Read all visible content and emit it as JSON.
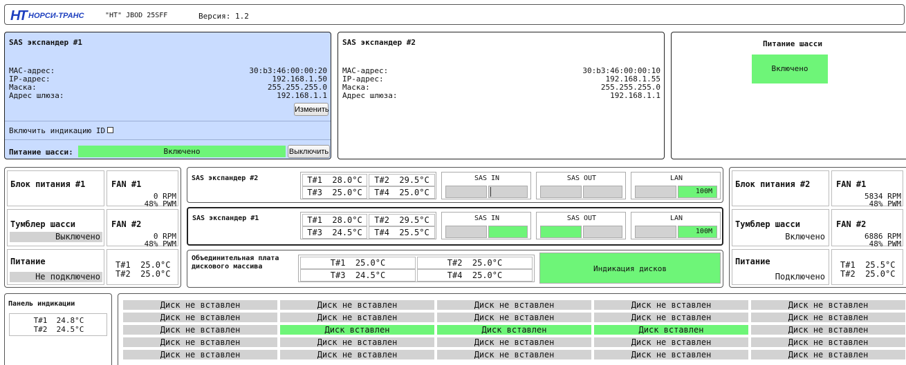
{
  "header": {
    "logo_text": "НОРСИ-ТРАНС",
    "device": "\"НТ\" JBOD 25SFF",
    "version": "Версия: 1.2"
  },
  "exp1_panel": {
    "title": "SAS экспандер #1",
    "mac_label": "MAC-адрес:",
    "mac": "30:b3:46:00:00:20",
    "ip_label": "IP-адрес:",
    "ip": "192.168.1.50",
    "mask_label": "Маска:",
    "mask": "255.255.255.0",
    "gw_label": "Адрес шлюза:",
    "gw": "192.168.1.1",
    "edit_button": "Изменить",
    "id_label": "Включить индикацию ID",
    "power_label": "Питание шасси:",
    "power_value": "Включено",
    "power_button": "Выключить"
  },
  "exp2_panel": {
    "title": "SAS экспандер #2",
    "mac_label": "MAC-адрес:",
    "mac": "30:b3:46:00:00:10",
    "ip_label": "IP-адрес:",
    "ip": "192.168.1.55",
    "mask_label": "Маска:",
    "mask": "255.255.255.0",
    "gw_label": "Адрес шлюза:",
    "gw": "192.168.1.1"
  },
  "chassis_power": {
    "title": "Питание шасси",
    "value": "Включено"
  },
  "psu1": {
    "title": "Блок питания #1",
    "fan1_title": "FAN #1",
    "fan1_rpm": "0 RPM",
    "fan1_pwm": "48% PWM",
    "switch_title": "Тумблер шасси",
    "switch_value": "Выключено",
    "fan2_title": "FAN #2",
    "fan2_rpm": "0 RPM",
    "fan2_pwm": "48% PWM",
    "power_title": "Питание",
    "power_value": "Не подключено",
    "t1": "T#1  25.0°C",
    "t2": "T#2  25.0°C"
  },
  "psu2": {
    "title": "Блок питания #2",
    "fan1_title": "FAN #1",
    "fan1_rpm": "5834 RPM",
    "fan1_pwm": "48% PWM",
    "switch_title": "Тумблер шасси",
    "switch_value": "Включено",
    "fan2_title": "FAN #2",
    "fan2_rpm": "6886 RPM",
    "fan2_pwm": "48% PWM",
    "power_title": "Питание",
    "power_value": "Подключено",
    "t1": "T#1  25.5°C",
    "t2": "T#2  25.0°C"
  },
  "exp2_status": {
    "title": "SAS экспандер #2",
    "t1": "T#1  28.0°C",
    "t2": "T#2  29.5°C",
    "t3": "T#3  25.0°C",
    "t4": "T#4  25.0°C",
    "sas_in": "SAS IN",
    "sas_out": "SAS OUT",
    "lan": "LAN",
    "lan_speed": "100M"
  },
  "exp1_status": {
    "title": "SAS экспандер #1",
    "t1": "T#1  28.0°C",
    "t2": "T#2  29.5°C",
    "t3": "T#3  24.5°C",
    "t4": "T#4  25.5°C",
    "sas_in": "SAS IN",
    "sas_out": "SAS OUT",
    "lan": "LAN",
    "lan_speed": "100M"
  },
  "backplane": {
    "title_line1": "Объединительная плата",
    "title_line2": "дискового массива",
    "t1": "T#1  25.0°C",
    "t2": "T#2  25.0°C",
    "t3": "T#3  24.5°C",
    "t4": "T#4  25.0°C",
    "indication_button": "Индикация дисков"
  },
  "indicator_panel": {
    "title": "Панель индикации",
    "t1": "T#1  24.8°C",
    "t2": "T#2  24.5°C"
  },
  "disks": {
    "absent": "Диск не вставлен",
    "present": "Диск вставлен",
    "slots": [
      [
        0,
        0,
        0,
        0,
        0
      ],
      [
        0,
        0,
        0,
        0,
        0
      ],
      [
        0,
        1,
        1,
        1,
        0
      ],
      [
        0,
        0,
        0,
        0,
        0
      ],
      [
        0,
        0,
        0,
        0,
        0
      ]
    ]
  },
  "colors": {
    "active": "#6ef578",
    "inactive": "#d2d2d2",
    "panel_selected": "#c9dcff"
  }
}
